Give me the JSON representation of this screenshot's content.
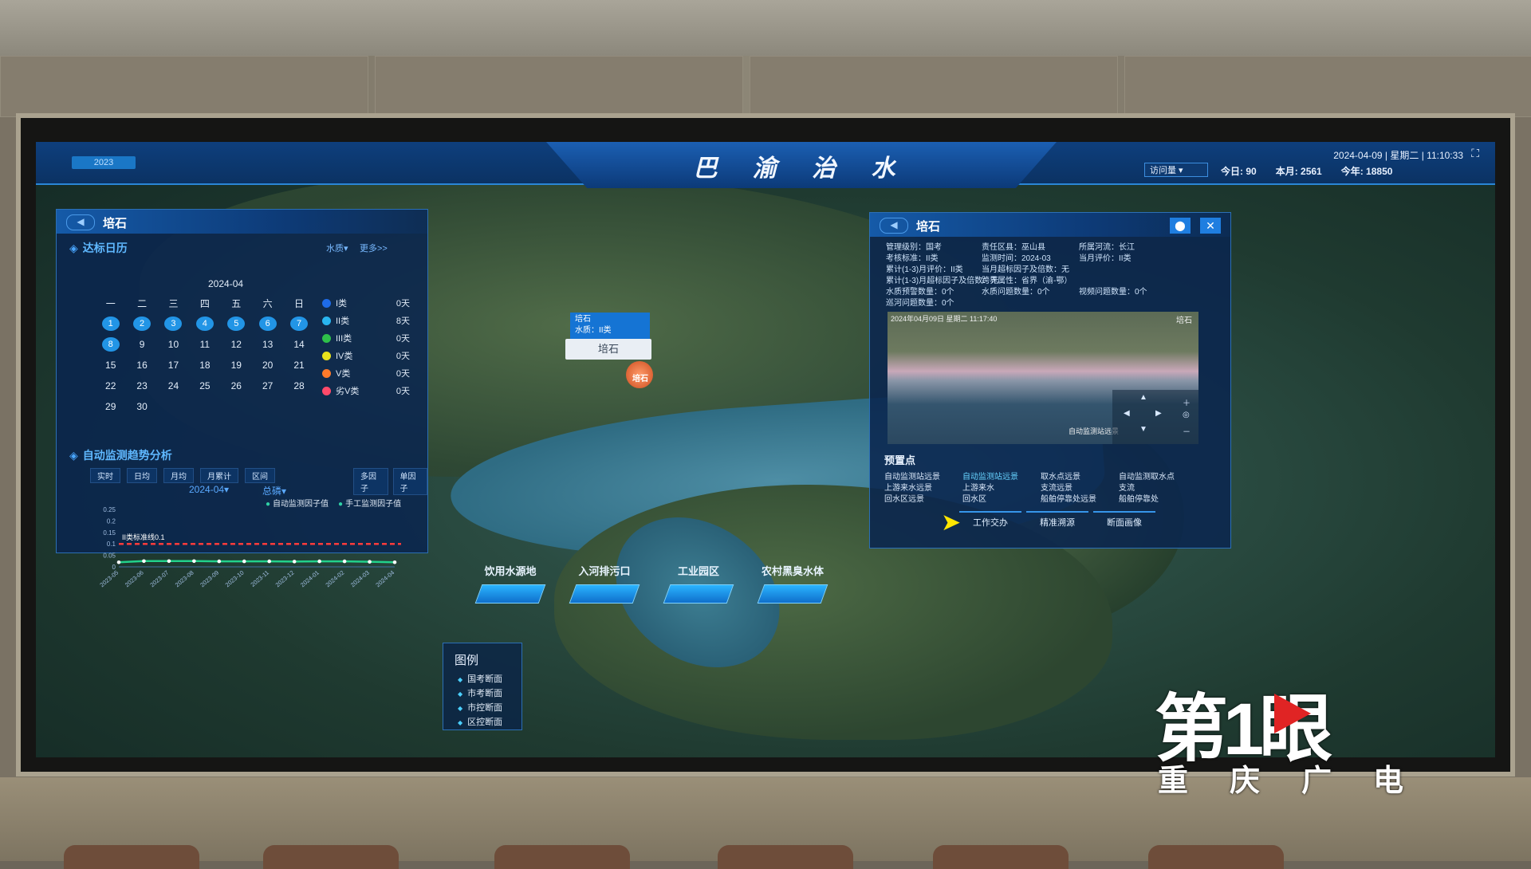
{
  "header": {
    "title": "巴 渝 治 水",
    "top_left_tag": "2023",
    "datetime": "2024-04-09 | 星期二 | 11:10:33",
    "select": "访问量",
    "stats": [
      "今日: 90",
      "本月: 2561",
      "今年: 18850"
    ]
  },
  "left_panel": {
    "station": "培石",
    "calendar_title": "达标日历",
    "filter": "水质",
    "more": "更多>>",
    "month": "2024-04",
    "weekdays": [
      "一",
      "二",
      "三",
      "四",
      "五",
      "六",
      "日"
    ],
    "weeks": [
      [
        "1",
        "2",
        "3",
        "4",
        "5",
        "6",
        "7"
      ],
      [
        "8",
        "9",
        "10",
        "11",
        "12",
        "13",
        "14"
      ],
      [
        "15",
        "16",
        "17",
        "18",
        "19",
        "20",
        "21"
      ],
      [
        "22",
        "23",
        "24",
        "25",
        "26",
        "27",
        "28"
      ],
      [
        "29",
        "30",
        "",
        "",
        "",
        "",
        ""
      ]
    ],
    "legend": [
      {
        "name": "I类",
        "value": "0天",
        "color": "#1e6be8"
      },
      {
        "name": "II类",
        "value": "8天",
        "color": "#29b5f0"
      },
      {
        "name": "III类",
        "value": "0天",
        "color": "#2ec04a"
      },
      {
        "name": "IV类",
        "value": "0天",
        "color": "#e8e21c"
      },
      {
        "name": "V类",
        "value": "0天",
        "color": "#ff7a2a"
      },
      {
        "name": "劣V类",
        "value": "0天",
        "color": "#ff4a6a"
      }
    ],
    "trend_title": "自动监测趋势分析",
    "tabs": [
      "实时",
      "日均",
      "月均",
      "月累计",
      "区间"
    ],
    "tabs_right": [
      "多因子",
      "单因子"
    ],
    "period": "2024-04",
    "factor": "总磷",
    "chart_legend": [
      "自动监测因子值",
      "手工监测因子值"
    ]
  },
  "chart_data": {
    "type": "line",
    "x": [
      "2023-05",
      "2023-06",
      "2023-07",
      "2023-08",
      "2023-09",
      "2023-10",
      "2023-11",
      "2023-12",
      "2024-01",
      "2024-02",
      "2024-03",
      "2024-04"
    ],
    "yticks": [
      "0.25",
      "0.2",
      "0.15",
      "0.1",
      "0.05",
      "0"
    ],
    "ylim": [
      0,
      0.25
    ],
    "threshold_label": "II类标准线0.1",
    "threshold": 0.1,
    "series": [
      {
        "name": "自动监测因子值",
        "values": [
          0.02,
          0.025,
          0.025,
          0.025,
          0.024,
          0.024,
          0.024,
          0.023,
          0.024,
          0.024,
          0.022,
          0.02
        ],
        "color": "#22d18b"
      }
    ]
  },
  "map": {
    "popup_name": "培石",
    "popup_quality": "水质：II类",
    "popup_button": "培石",
    "marker_label": "培石",
    "legend_title": "图例",
    "legend_items": [
      "国考断面",
      "市考断面",
      "市控断面",
      "区控断面"
    ],
    "bottom_buttons": [
      "饮用水源地",
      "入河排污口",
      "工业园区",
      "农村黑臭水体"
    ]
  },
  "right_panel": {
    "station": "培石",
    "info_rows": [
      [
        "管理级别：国考",
        "责任区县：巫山县",
        "所属河流：长江"
      ],
      [
        "考核标准：II类",
        "监测时间：2024-03",
        "当月评价：II类"
      ],
      [
        "累计(1-3)月评价：II类",
        "当月超标因子及倍数：无",
        ""
      ],
      [
        "累计(1-3)月超标因子及倍数：无",
        "跨界属性：省界（渝-鄂）",
        ""
      ],
      [
        "水质预警数量：0个",
        "水质问题数量：0个",
        "视频问题数量：0个"
      ],
      [
        "巡河问题数量：0个",
        "",
        ""
      ]
    ],
    "video_timestamp": "2024年04月09日 星期二 11:17:40",
    "video_name": "培石",
    "video_watermark": "自动监测站远景",
    "presets_title": "预置点",
    "presets": [
      [
        "自动监测站远景",
        "自动监测站远景",
        "取水点远景",
        "自动监测取水点"
      ],
      [
        "上游来水远景",
        "上游来水",
        "支流远景",
        "支流"
      ],
      [
        "回水区远景",
        "回水区",
        "船舶停靠处远景",
        "船舶停靠处"
      ]
    ],
    "buttons": [
      "工作交办",
      "精准溯源",
      "断面画像"
    ]
  },
  "watermark": {
    "big": "第1眼",
    "sub": "重庆广电"
  }
}
